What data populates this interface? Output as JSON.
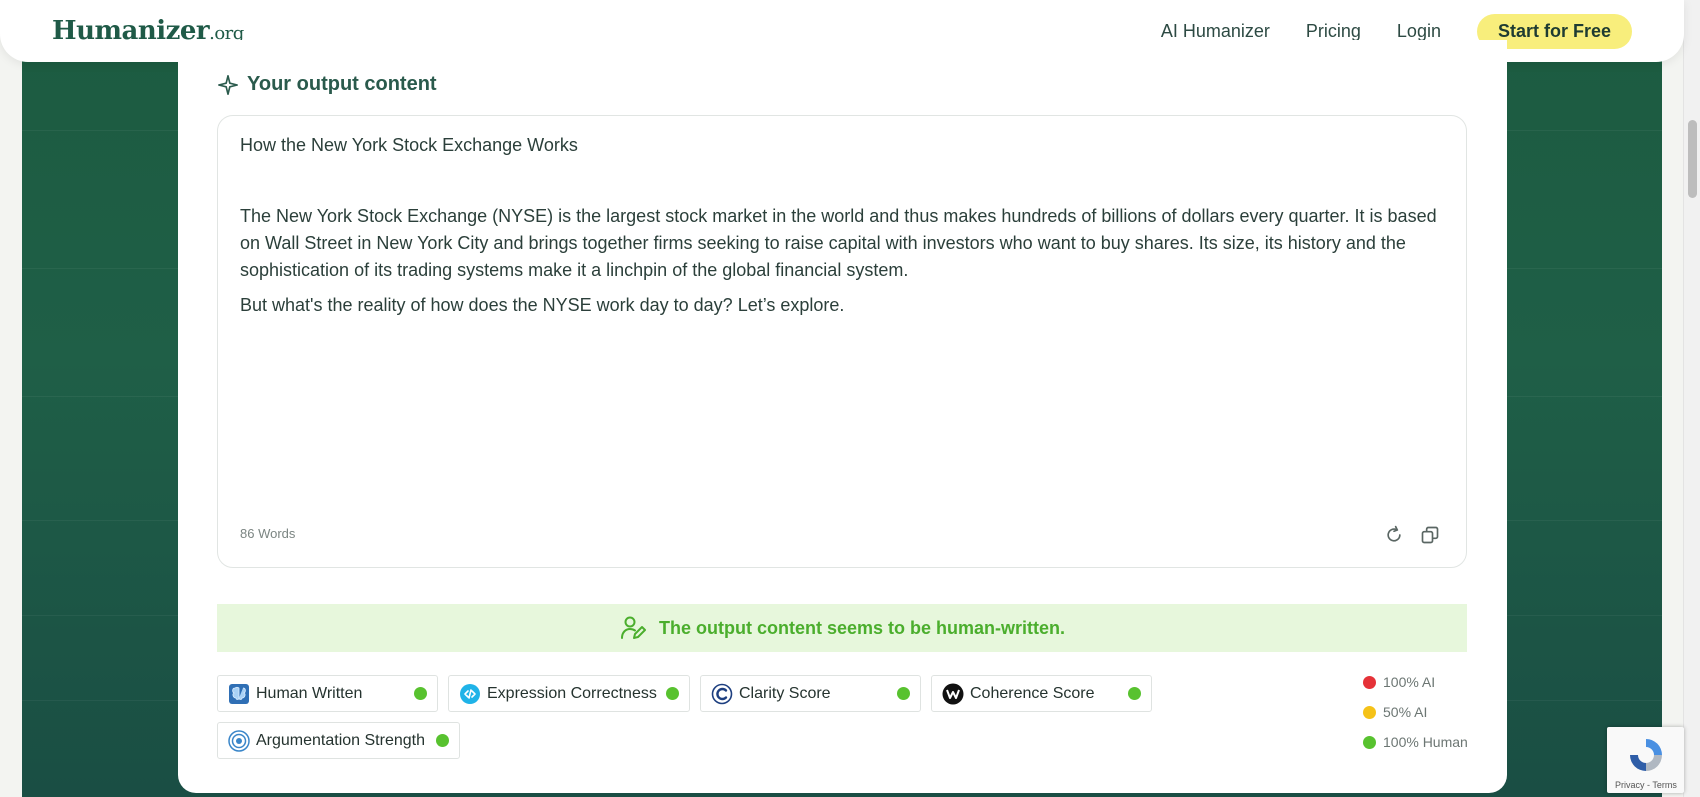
{
  "header": {
    "logo_main": "Humanizer",
    "logo_suffix": ".org",
    "nav": [
      "AI Humanizer",
      "Pricing",
      "Login"
    ],
    "cta_label": "Start for Free"
  },
  "output": {
    "title": "Your output content",
    "heading": "How the New York Stock  Exchange Works",
    "paragraphs": [
      "The New York Stock Exchange (NYSE) is the largest stock market in the world and  thus makes hundreds of billions of dollars every quarter. It is based  on Wall Street in New York City and brings together firms seeking to raise capital with investors who want to buy shares. Its size, its history and the sophistication of its  trading systems make it a linchpin of the global financial system.",
      "But what's the reality  of how does the NYSE work day to day? Let’s explore."
    ],
    "word_count": "86 Words"
  },
  "status": {
    "message": "The output content seems to be human-written.",
    "color": "#4bae2d"
  },
  "metrics": [
    {
      "label": "Human Written",
      "icon": "brain-icon"
    },
    {
      "label": "Expression Correctness",
      "icon": "expression-icon"
    },
    {
      "label": "Clarity Score",
      "icon": "clarity-c-icon"
    },
    {
      "label": "Coherence Score",
      "icon": "coherence-w-icon"
    },
    {
      "label": "Argumentation Strength",
      "icon": "target-icon"
    }
  ],
  "legend": [
    {
      "label": "100% AI",
      "color": "#e53238"
    },
    {
      "label": "50% AI",
      "color": "#f5c218"
    },
    {
      "label": "100% Human",
      "color": "#58c22f"
    }
  ],
  "recaptcha": {
    "text": "Privacy - Terms"
  }
}
